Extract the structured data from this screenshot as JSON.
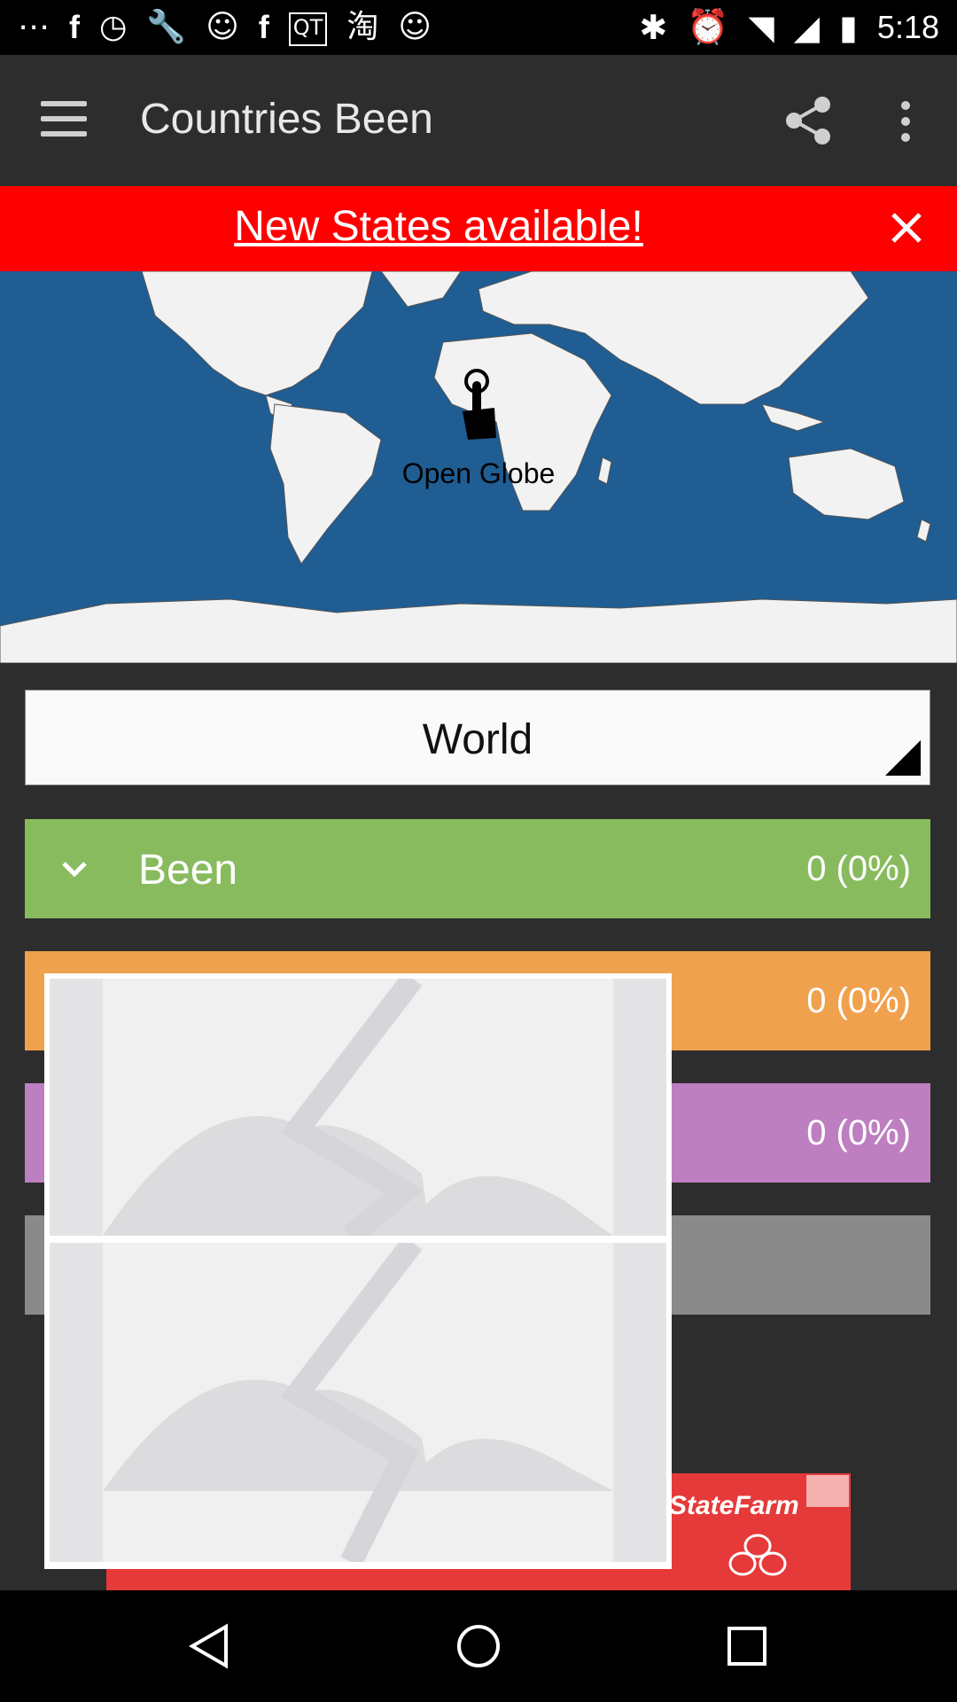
{
  "status_bar": {
    "time": "5:18",
    "left_icons": [
      "more-icon",
      "facebook-icon",
      "timer-icon",
      "wrench-icon",
      "smiley-icon",
      "facebook-icon",
      "qt-icon",
      "chinese-app-icon",
      "smiley-icon"
    ],
    "right_icons": [
      "bluetooth-icon",
      "alarm-icon",
      "wifi-icon",
      "cell-signal-icon",
      "battery-icon"
    ]
  },
  "app_bar": {
    "title": "Countries Been",
    "menu_icon": "hamburger-menu-icon",
    "share_icon": "share-icon",
    "more_icon": "overflow-menu-icon"
  },
  "banner": {
    "text": "New States available!",
    "close_icon": "close-icon",
    "background": "#ff0000"
  },
  "map": {
    "label": "Open Globe",
    "ocean_color": "#1f5d93",
    "land_color": "#f2f2f2"
  },
  "region_selector": {
    "value": "World"
  },
  "rows": [
    {
      "label": "Been",
      "value": "0 (0%)",
      "color": "#88bb5e",
      "icon": "chevron-down-icon"
    },
    {
      "label": "",
      "value": "0 (0%)",
      "color": "#f0a14e"
    },
    {
      "label": "",
      "value": "0 (0%)",
      "color": "#be7fc0"
    },
    {
      "label": "",
      "value": "",
      "color": "#8a8a8a"
    }
  ],
  "ad": {
    "brand": "StateFarm",
    "color": "#e63939"
  },
  "nav_bar": {
    "back_icon": "back-icon",
    "home_icon": "home-icon",
    "recents_icon": "recents-icon"
  }
}
